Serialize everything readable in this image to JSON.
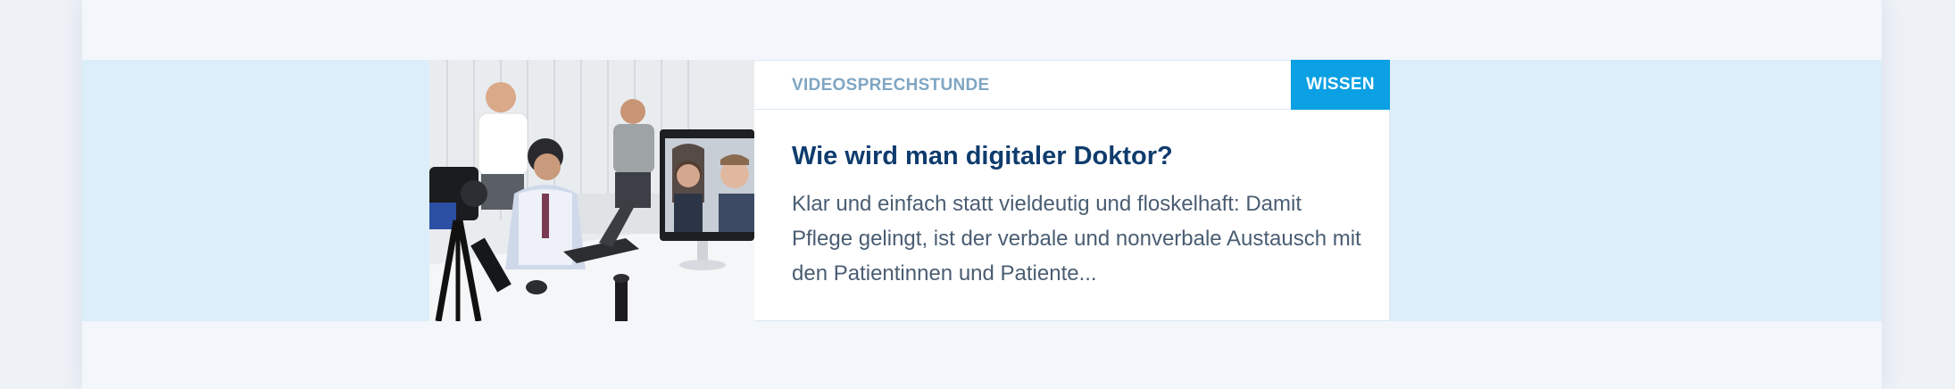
{
  "teaser_card": {
    "category": "VIDEOSPRECHSTUNDE",
    "tag": "WISSEN",
    "title": "Wie wird man digitaler Doktor?",
    "description": "Klar und einfach statt vieldeutig und floskelhaft: Damit Pflege gelingt, ist der verbale und nonverbale Austausch mit den Patientinnen und Patiente...",
    "image_alt": "Ärzte bei einer Videosprechstunde am Computer"
  },
  "colors": {
    "page_background": "#f3f7fb",
    "band_background": "#dbeef9",
    "tag_background": "#0aa0e3",
    "title_color": "#0f3c6e",
    "category_color": "#7fa6c3"
  }
}
